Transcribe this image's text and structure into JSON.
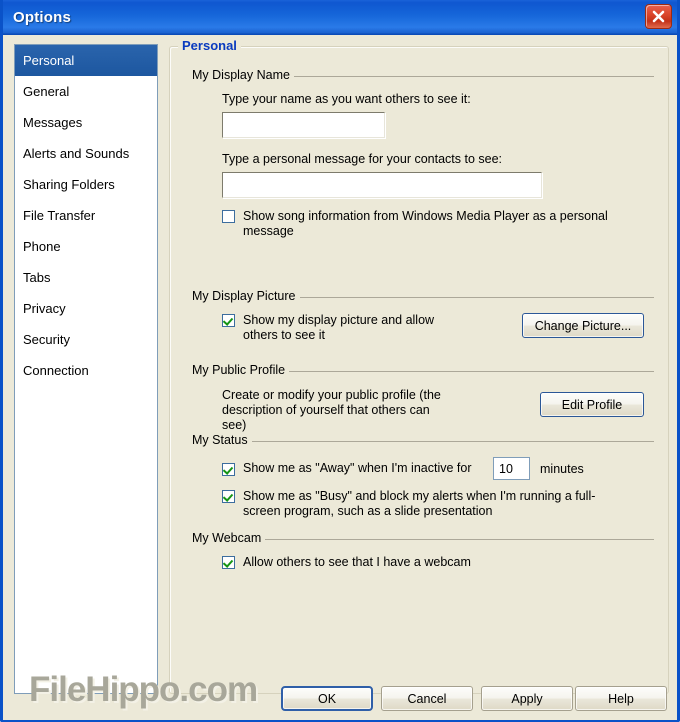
{
  "window": {
    "title": "Options",
    "close_icon": "close-icon",
    "frame_color": "#0A52C8",
    "titlebar_color": "#1565d9",
    "background_color": "#ECE9D8"
  },
  "sidebar": {
    "selected_index": 0,
    "items": [
      {
        "label": "Personal"
      },
      {
        "label": "General"
      },
      {
        "label": "Messages"
      },
      {
        "label": "Alerts and Sounds"
      },
      {
        "label": "Sharing Folders"
      },
      {
        "label": "File Transfer"
      },
      {
        "label": "Phone"
      },
      {
        "label": "Tabs"
      },
      {
        "label": "Privacy"
      },
      {
        "label": "Security"
      },
      {
        "label": "Connection"
      }
    ]
  },
  "panel": {
    "legend": "Personal",
    "legend_color": "#0A3BBF",
    "display_name": {
      "group_title": "My Display Name",
      "name_label": "Type your name as you want others to see it:",
      "name_value": "",
      "message_label": "Type a personal message for your contacts to see:",
      "message_value": "",
      "song_checkbox_label": "Show song information from Windows Media Player as a personal message",
      "song_checkbox_checked": false
    },
    "display_picture": {
      "group_title": "My Display Picture",
      "checkbox_label": "Show my display picture and allow others to see it",
      "checkbox_checked": true,
      "change_button": "Change Picture..."
    },
    "public_profile": {
      "group_title": "My Public Profile",
      "description": "Create or modify your public profile (the description of yourself that others can see)",
      "edit_button": "Edit Profile"
    },
    "status": {
      "group_title": "My Status",
      "away_checkbox_label": "Show me as \"Away\" when I'm inactive for",
      "away_checkbox_checked": true,
      "away_minutes": "10",
      "minutes_label": "minutes",
      "busy_checkbox_label": "Show me as \"Busy\" and block my alerts when I'm running a full-screen program, such as a slide presentation",
      "busy_checkbox_checked": true
    },
    "webcam": {
      "group_title": "My Webcam",
      "checkbox_label": "Allow others to see that I have a webcam",
      "checkbox_checked": true
    }
  },
  "footer": {
    "ok": "OK",
    "cancel": "Cancel",
    "apply": "Apply",
    "help": "Help",
    "watermark": "FileHippo.com",
    "watermark_color": "#a8a79a"
  }
}
